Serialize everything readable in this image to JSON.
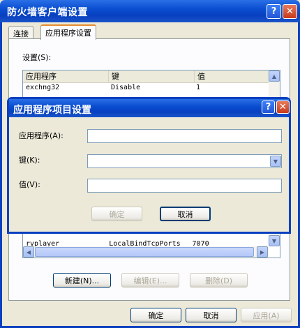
{
  "window": {
    "title": "防火墙客户端设置",
    "help": "?",
    "close": "✕"
  },
  "tabs": [
    {
      "label": "连接"
    },
    {
      "label": "应用程序设置"
    }
  ],
  "settings_label": "设置(S):",
  "list": {
    "headers": [
      "应用程序",
      "键",
      "值"
    ],
    "rows_top": [
      [
        "exchng32",
        "Disable",
        "1"
      ]
    ],
    "rows_bottom": [
      [
        "rvplayer",
        "LocalBindTcpPorts",
        "7070"
      ]
    ]
  },
  "buttons": {
    "new": "新建(N)...",
    "edit": "编辑(E)...",
    "delete": "删除(D)",
    "ok": "确定",
    "cancel": "取消",
    "apply": "应用(A)"
  },
  "dialog": {
    "title": "应用程序项目设置",
    "help": "?",
    "close": "✕",
    "app_label": "应用程序(A):",
    "app_value": "",
    "key_label": "键(K):",
    "key_value": "",
    "val_label": "值(V):",
    "val_value": "",
    "ok": "确定",
    "cancel": "取消"
  },
  "colors": {
    "title_bar": "#0840c0",
    "tab_accent": "#e68b2c",
    "close_button": "#c8391a"
  }
}
